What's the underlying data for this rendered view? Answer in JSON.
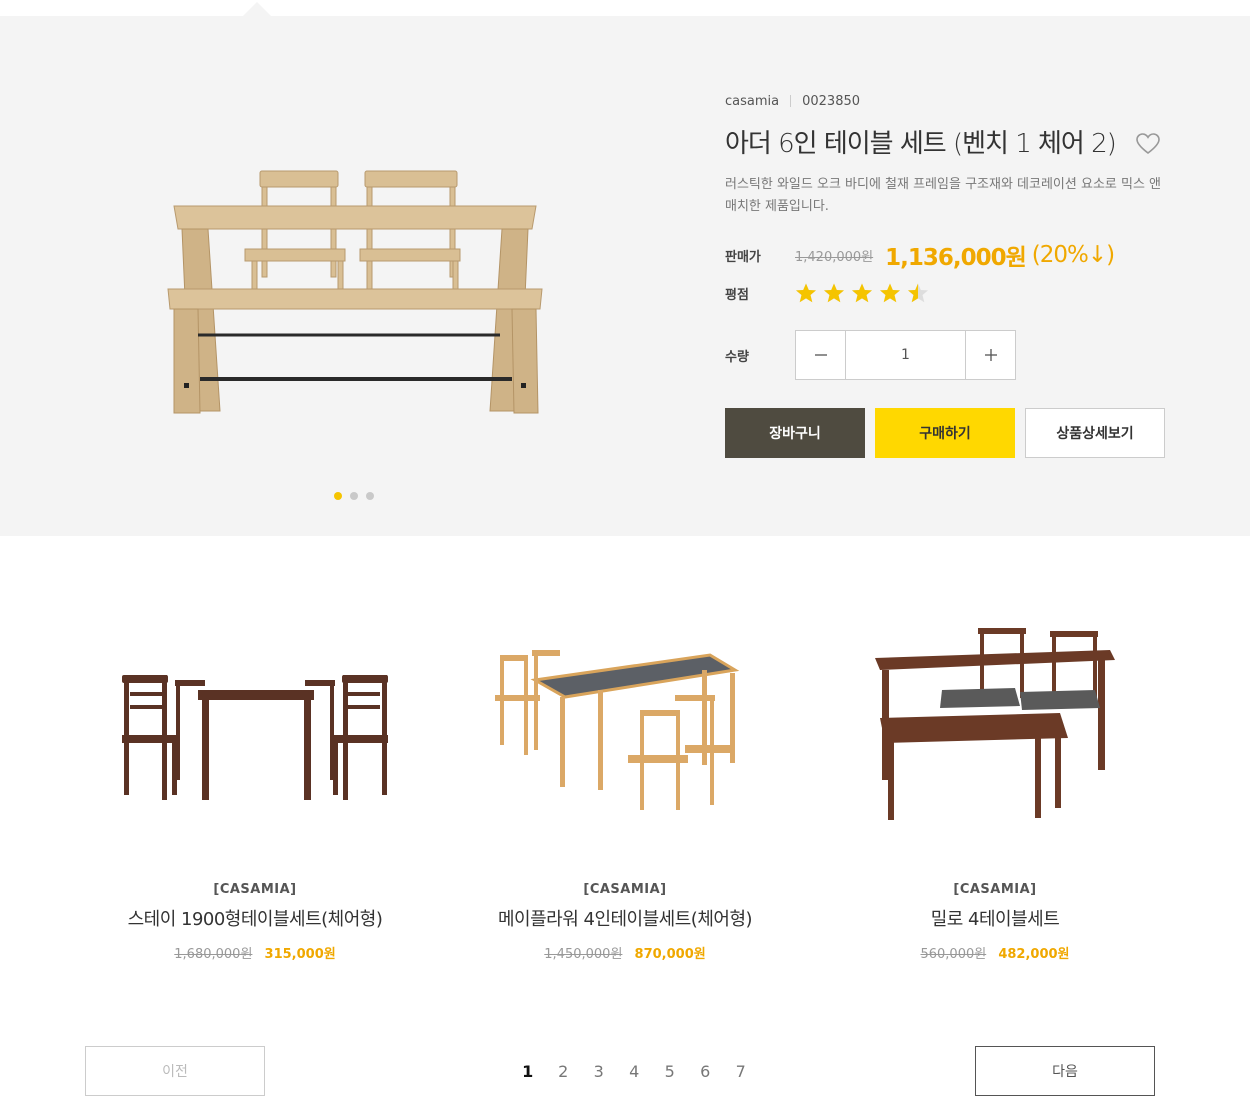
{
  "hero": {
    "brand": "casamia",
    "code": "0023850",
    "title": "아더 6인 테이블 세트 (벤치 1 체어 2)",
    "description": "러스틱한 와일드 오크 바디에 철재 프레임을 구조재와 데코레이션 요소로 믹스 앤 매치한 제품입니다.",
    "price_label": "판매가",
    "original_price": "1,420,000원",
    "sale_price": "1,136,000원",
    "discount": "(20%↓)",
    "rating_label": "평점",
    "rating": 4.5,
    "rating_max": 5,
    "qty_label": "수량",
    "qty_value": "1",
    "cart_label": "장바구니",
    "buy_label": "구매하기",
    "detail_label": "상품상세보기",
    "slides": 3,
    "active_slide": 1
  },
  "products": [
    {
      "brand": "[CASAMIA]",
      "name": "스테이 1900형테이블세트(체어형)",
      "original": "1,680,000원",
      "sale": "315,000원"
    },
    {
      "brand": "[CASAMIA]",
      "name": "메이플라워 4인테이블세트(체어형)",
      "original": "1,450,000원",
      "sale": "870,000원"
    },
    {
      "brand": "[CASAMIA]",
      "name": "밀로 4테이블세트",
      "original": "560,000원",
      "sale": "482,000원"
    }
  ],
  "pagination": {
    "prev": "이전",
    "next": "다음",
    "pages": [
      "1",
      "2",
      "3",
      "4",
      "5",
      "6",
      "7"
    ],
    "current": "1"
  },
  "colors": {
    "accent": "#f0a800",
    "buy": "#ffd800",
    "cart": "#4f4b40"
  }
}
